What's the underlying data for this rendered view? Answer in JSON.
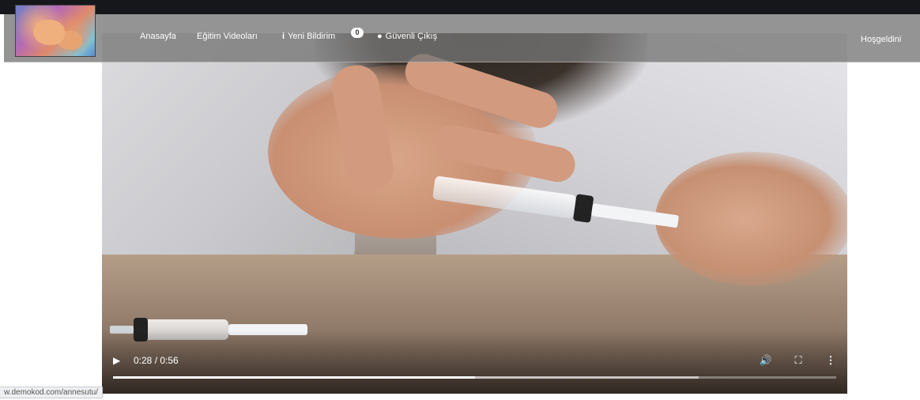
{
  "header": {
    "logo_icon": "breastfeeding-baby-logo",
    "nav": {
      "home": "Anasayfa",
      "videos": "Eğitim Videoları",
      "notifications_icon": "info-icon",
      "notifications_label": "Yeni Bildirim",
      "notifications_count": "0",
      "logout_icon": "user-icon",
      "logout_label": "Güvenli Çıkış"
    },
    "welcome": "Hoşgeldini"
  },
  "video": {
    "current_time": "0:28",
    "duration": "0:56",
    "time_display": "0:28 / 0:56",
    "played_fraction": 0.5,
    "buffered_fraction": 0.81,
    "controls": {
      "play_icon": "play-icon",
      "volume_icon": "volume-icon",
      "fullscreen_icon": "fullscreen-icon",
      "more_icon": "more-vertical-icon"
    }
  },
  "status_bar": {
    "url": "w.demokod.com/annesutu/"
  },
  "colors": {
    "topbar": "#16171a",
    "header_overlay": "#767676",
    "text": "#ffffff"
  }
}
